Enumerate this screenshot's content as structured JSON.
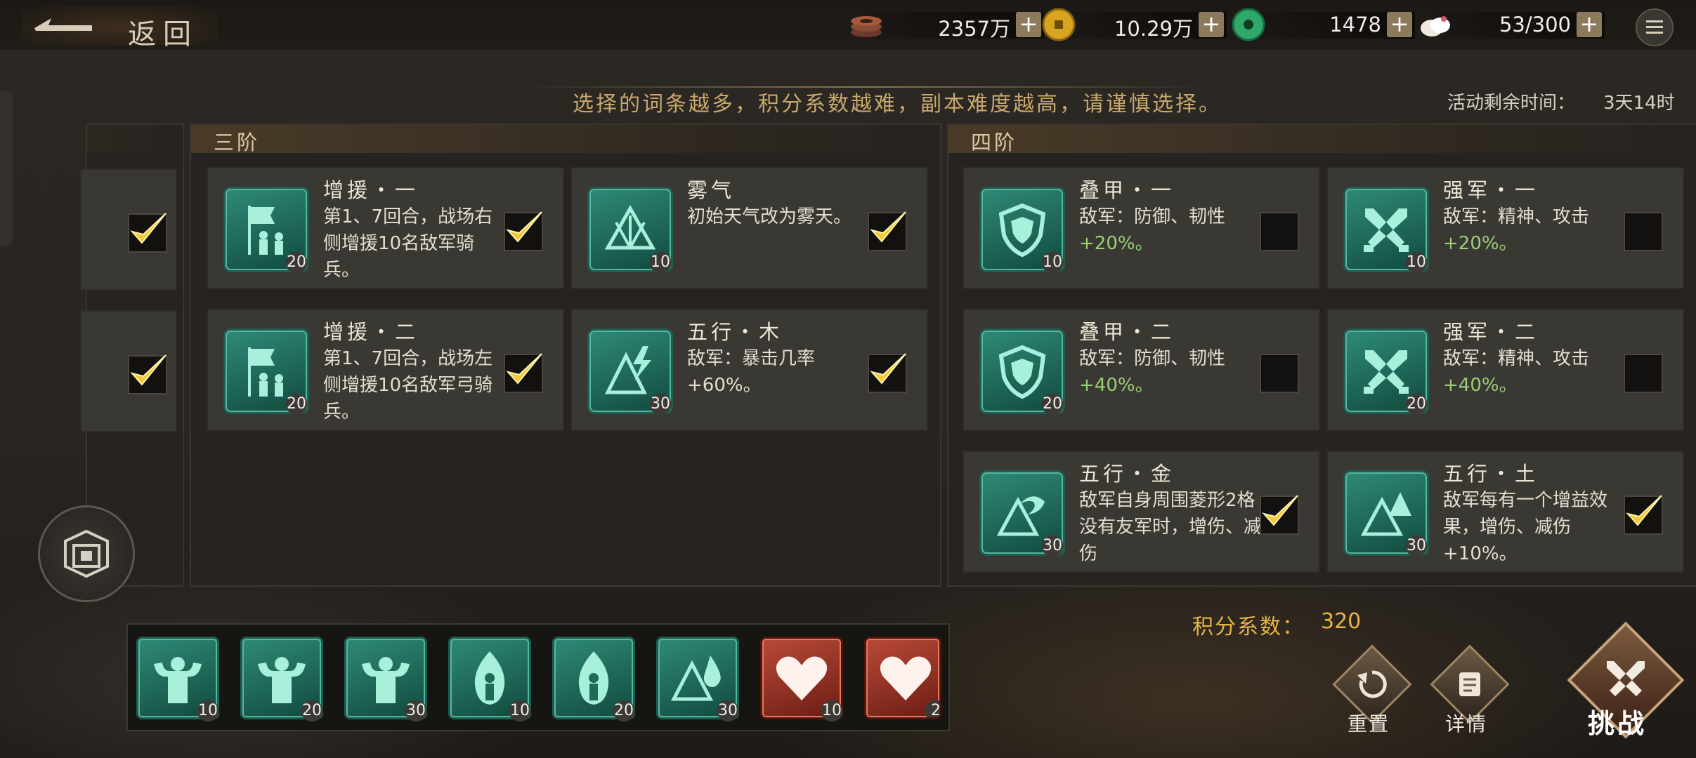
{
  "topbar": {
    "back_label": "返回",
    "resources": [
      {
        "icon": "coin-stack-icon",
        "value": "2357万",
        "plus": "+"
      },
      {
        "icon": "gold-coin-icon",
        "value": "10.29万",
        "plus": "+"
      },
      {
        "icon": "jade-icon",
        "value": "1478",
        "plus": "+"
      },
      {
        "icon": "steamed-bun-icon",
        "value": "53/300",
        "plus": "+"
      }
    ],
    "menu_icon": "menu-icon"
  },
  "hint": "选择的词条越多，积分系数越难，副本难度越高，请谨慎选择。",
  "timer": {
    "label": "活动剩余时间：",
    "value": "3天14时"
  },
  "tiers": [
    {
      "title": "三阶",
      "cards": [
        {
          "name": "增援・一",
          "desc": "第1、7回合，战场右侧增援10名敌军骑兵。",
          "level": "20",
          "checked": true,
          "icon": "banner-reinforce-icon"
        },
        {
          "name": "雾气",
          "desc": "初始天气改为雾天。",
          "level": "10",
          "checked": true,
          "icon": "fan-fog-icon"
        },
        {
          "name": "增援・二",
          "desc": "第1、7回合，战场左侧增援10名敌军弓骑兵。",
          "level": "20",
          "checked": true,
          "icon": "banner-reinforce-icon"
        },
        {
          "name": "五行・木",
          "desc": "敌军：暴击几率",
          "bonus": "+60%。",
          "level": "30",
          "checked": true,
          "icon": "fan-lightning-icon"
        }
      ]
    },
    {
      "title": "四阶",
      "cards": [
        {
          "name": "叠甲・一",
          "desc": "敌军：防御、韧性",
          "bonus": "+20%。",
          "level": "10",
          "checked": false,
          "icon": "shield-icon"
        },
        {
          "name": "强军・一",
          "desc": "敌军：精神、攻击",
          "bonus": "+20%。",
          "level": "10",
          "checked": false,
          "icon": "crossed-swords-icon"
        },
        {
          "name": "叠甲・二",
          "desc": "敌军：防御、韧性",
          "bonus": "+40%。",
          "level": "20",
          "checked": false,
          "icon": "shield-icon"
        },
        {
          "name": "强军・二",
          "desc": "敌军：精神、攻击",
          "bonus": "+40%。",
          "level": "20",
          "checked": false,
          "icon": "crossed-swords-icon"
        },
        {
          "name": "五行・金",
          "desc": "敌军自身周围菱形2格没有友军时，增伤、减伤",
          "level": "30",
          "checked": true,
          "icon": "fan-metal-icon"
        },
        {
          "name": "五行・土",
          "desc": "敌军每有一个增益效果，增伤、减伤",
          "bonus": "+10%。",
          "level": "30",
          "checked": true,
          "icon": "fan-earth-icon"
        }
      ]
    }
  ],
  "selected_tray": [
    {
      "icon": "muscle-icon",
      "level": "10",
      "tone": "green"
    },
    {
      "icon": "muscle-icon",
      "level": "20",
      "tone": "green"
    },
    {
      "icon": "muscle-icon",
      "level": "30",
      "tone": "green"
    },
    {
      "icon": "flame-figure-icon",
      "level": "10",
      "tone": "green"
    },
    {
      "icon": "flame-figure-icon",
      "level": "20",
      "tone": "green"
    },
    {
      "icon": "fan-water-icon",
      "level": "30",
      "tone": "green"
    },
    {
      "icon": "heart-icon",
      "level": "10",
      "tone": "red"
    },
    {
      "icon": "heart-icon",
      "level": "2",
      "tone": "red"
    }
  ],
  "score": {
    "label": "积分系数：",
    "value": "320"
  },
  "actions": {
    "reset": "重置",
    "details": "详情",
    "challenge": "挑战"
  },
  "colors": {
    "accent_gold": "#e7b546",
    "icon_green": "#2f8a77",
    "bonus_green": "#9acf76",
    "icon_red": "#b94a38"
  }
}
